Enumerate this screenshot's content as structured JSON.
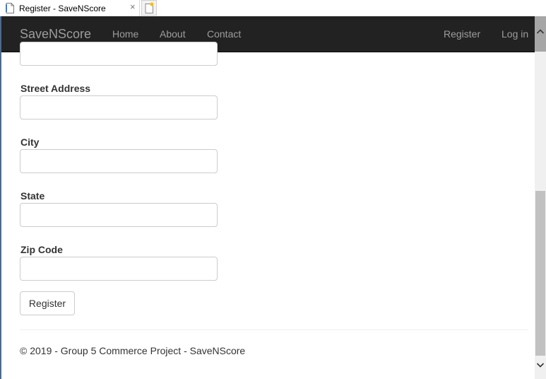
{
  "browser": {
    "tab_title": "Register - SaveNScore",
    "close_glyph": "×"
  },
  "navbar": {
    "brand": "SaveNScore",
    "links": [
      "Home",
      "About",
      "Contact"
    ],
    "right_links": [
      "Register",
      "Log in"
    ]
  },
  "form": {
    "fields": [
      {
        "label": "Street Address",
        "value": ""
      },
      {
        "label": "City",
        "value": ""
      },
      {
        "label": "State",
        "value": ""
      },
      {
        "label": "Zip Code",
        "value": ""
      }
    ],
    "top_partial_field_value": "",
    "submit_label": "Register"
  },
  "footer": {
    "text": "© 2019 - Group 5 Commerce Project - SaveNScore"
  },
  "colors": {
    "navbar_bg": "#222222",
    "nav_text": "#9d9d9d",
    "input_border": "#cccccc"
  },
  "icons": {
    "tab_page": "page-icon",
    "new_tab": "new-tab-icon",
    "scroll_up": "chevron-up-icon",
    "scroll_down": "chevron-down-icon"
  }
}
